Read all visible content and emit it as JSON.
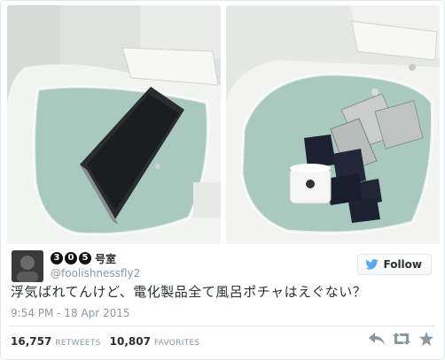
{
  "tweet": {
    "display_name_digits": [
      "3",
      "0",
      "5"
    ],
    "display_name_suffix": "号室",
    "handle": "@foolishnessfly2",
    "follow_label": "Follow",
    "text": "浮気ばれてんけど、電化製品全て風呂ポチャはえぐない？",
    "timestamp": "9:54 PM - 18 Apr 2015",
    "retweets_count": "16,757",
    "retweets_label": "RETWEETS",
    "favorites_count": "10,807",
    "favorites_label": "FAVORITES"
  },
  "icons": {
    "follow": "twitter-bird-icon",
    "reply": "reply-icon",
    "retweet": "retweet-icon",
    "favorite": "star-icon"
  },
  "colors": {
    "bath_water": "#a9c9bf",
    "tub": "#eef1ee",
    "text_dark": "#292f33",
    "text_muted": "#8899a6",
    "twitter_blue": "#55acee"
  }
}
